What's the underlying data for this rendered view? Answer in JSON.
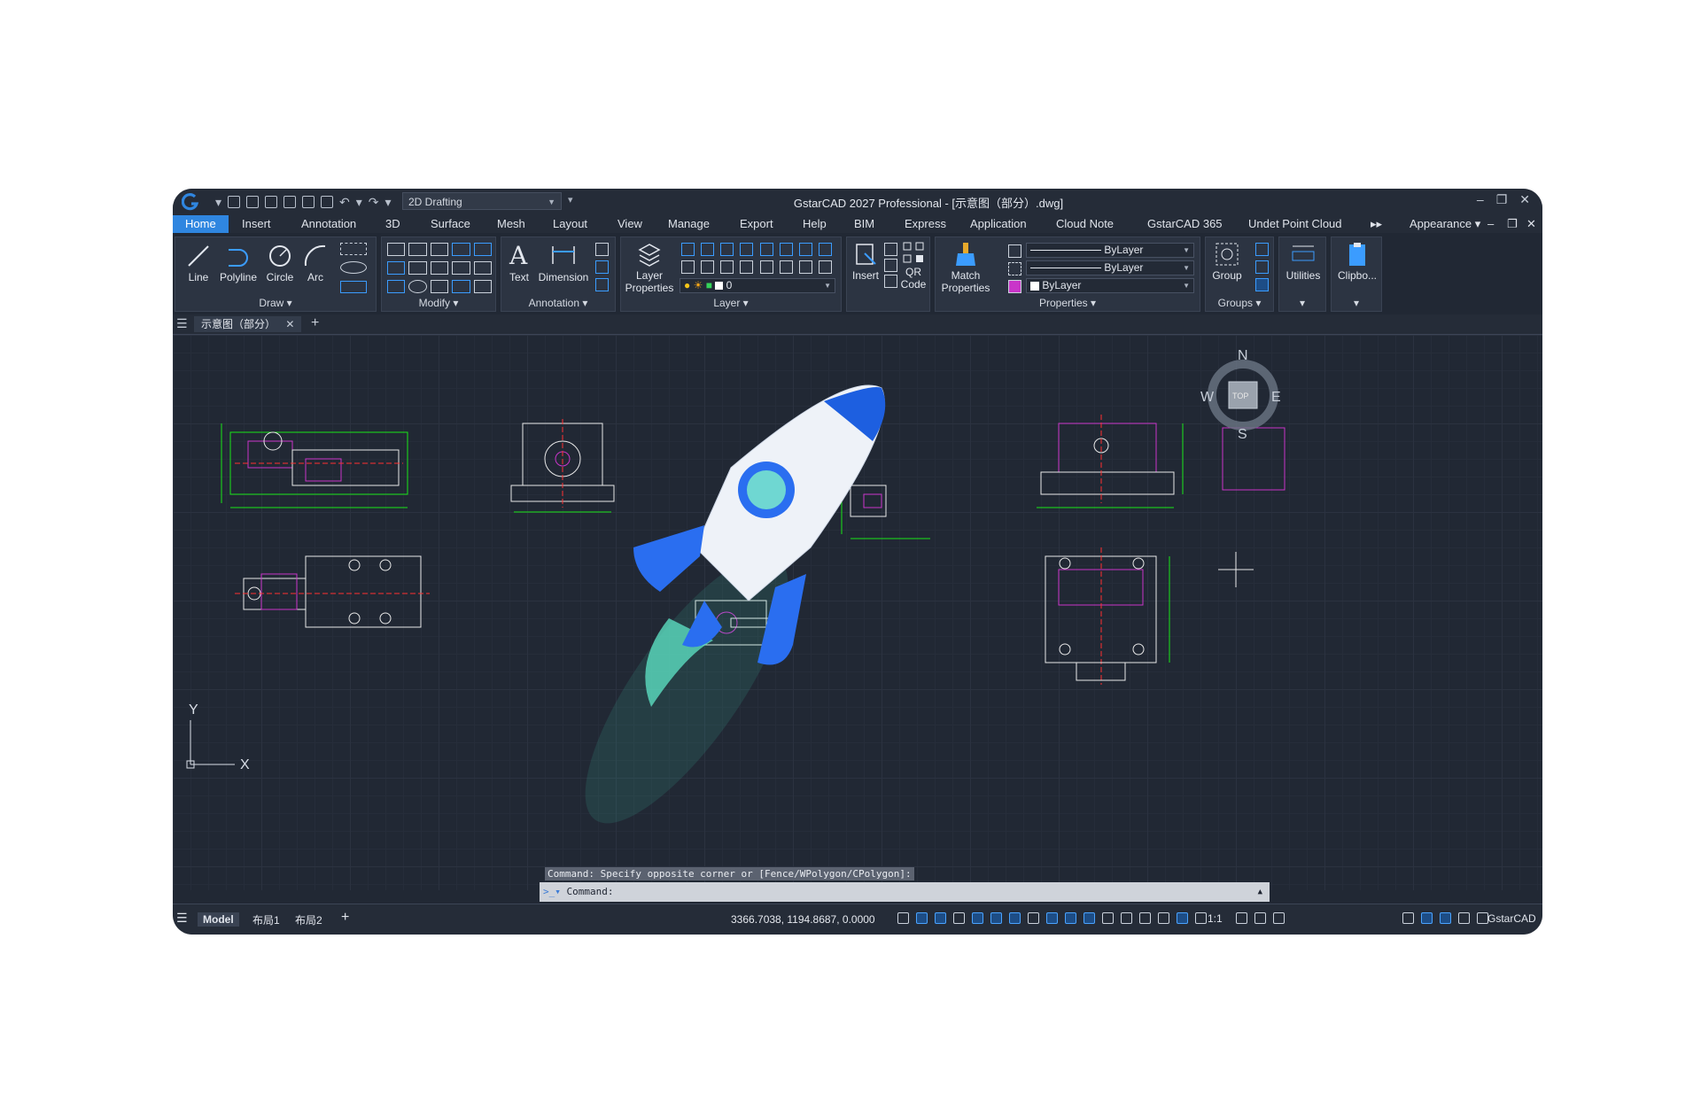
{
  "window": {
    "title": "GstarCAD 2027 Professional - [示意图（部分）.dwg]",
    "workspace": "2D Drafting"
  },
  "menu": {
    "items": [
      "Home",
      "Insert",
      "Annotation",
      "3D",
      "Surface",
      "Mesh",
      "Layout",
      "View",
      "Manage",
      "Export",
      "Help",
      "BIM",
      "Express",
      "Application",
      "Cloud Note",
      "GstarCAD 365",
      "Undet Point Cloud"
    ],
    "appearance": "Appearance"
  },
  "ribbon": {
    "draw": {
      "title": "Draw ▾",
      "tools": [
        "Line",
        "Polyline",
        "Circle",
        "Arc"
      ]
    },
    "modify": {
      "title": "Modify ▾"
    },
    "annotation": {
      "title": "Annotation ▾",
      "tools": [
        "Text",
        "Dimension"
      ]
    },
    "layer": {
      "title": "Layer ▾",
      "layer_properties": "Layer Properties",
      "current_layer": "0"
    },
    "block": {
      "insert": "Insert",
      "qr_code": "QR Code"
    },
    "properties": {
      "title": "Properties ▾",
      "match_properties": "Match Properties",
      "color": "ByLayer",
      "linetype": "ByLayer",
      "lineweight": "ByLayer"
    },
    "groups": {
      "title": "Groups ▾",
      "group": "Group"
    },
    "utilities": "Utilities",
    "clipboard": "Clipbo..."
  },
  "document_tab": "示意图（部分）",
  "viewcube": {
    "n": "N",
    "s": "S",
    "e": "E",
    "w": "W",
    "face": "TOP"
  },
  "ucs": {
    "x": "X",
    "y": "Y"
  },
  "command": {
    "history": "Command: Specify opposite corner or [Fence/WPolygon/CPolygon]:",
    "prompt": "Command:"
  },
  "status": {
    "model": "Model",
    "layout1": "布局1",
    "layout2": "布局2",
    "coordinates": "3366.7038, 1194.8687, 0.0000",
    "scale": "1:1",
    "brand": "GstarCAD"
  },
  "colors": {
    "accent": "#2f86e0",
    "canvas": "#212834",
    "drawing_white": "#e8e8e8",
    "drawing_green": "#19e619",
    "drawing_magenta": "#c935c9",
    "drawing_red": "#ff3030"
  }
}
